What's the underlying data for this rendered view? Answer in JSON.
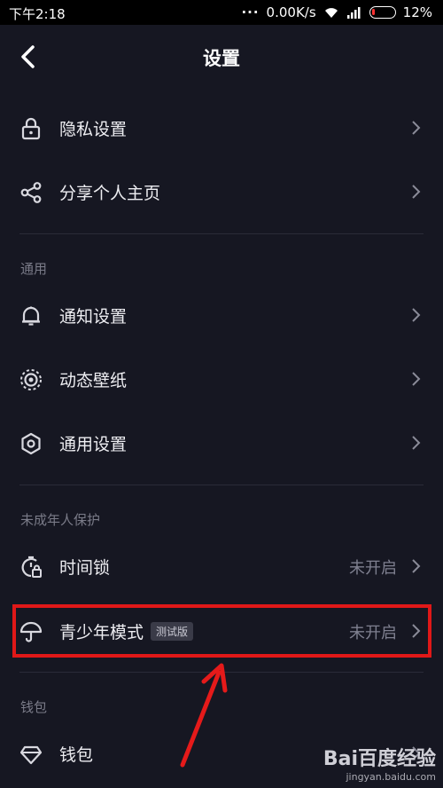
{
  "status_bar": {
    "time": "下午2:18",
    "dots": "···",
    "speed": "0.00K/s",
    "battery": "12%",
    "battery_level": 0.12
  },
  "header": {
    "title": "设置"
  },
  "rows": {
    "privacy": {
      "label": "隐私设置",
      "icon": "lock-icon"
    },
    "share": {
      "label": "分享个人主页",
      "icon": "share-icon"
    },
    "notify": {
      "label": "通知设置",
      "icon": "bell-icon"
    },
    "wallpaper": {
      "label": "动态壁纸",
      "icon": "wallpaper-icon"
    },
    "general": {
      "label": "通用设置",
      "icon": "hexagon-icon"
    },
    "timelock": {
      "label": "时间锁",
      "value": "未开启",
      "icon": "timer-lock-icon"
    },
    "teen": {
      "label": "青少年模式",
      "tag": "测试版",
      "value": "未开启",
      "icon": "umbrella-icon"
    },
    "wallet": {
      "label": "钱包",
      "icon": "diamond-icon"
    }
  },
  "sections": {
    "general": "通用",
    "minor": "未成年人保护",
    "wallet": "钱包"
  },
  "watermark": {
    "logo": "Bai百度经验",
    "url": "jingyan.baidu.com"
  },
  "colors": {
    "background": "#161722",
    "highlight": "#e01818"
  }
}
